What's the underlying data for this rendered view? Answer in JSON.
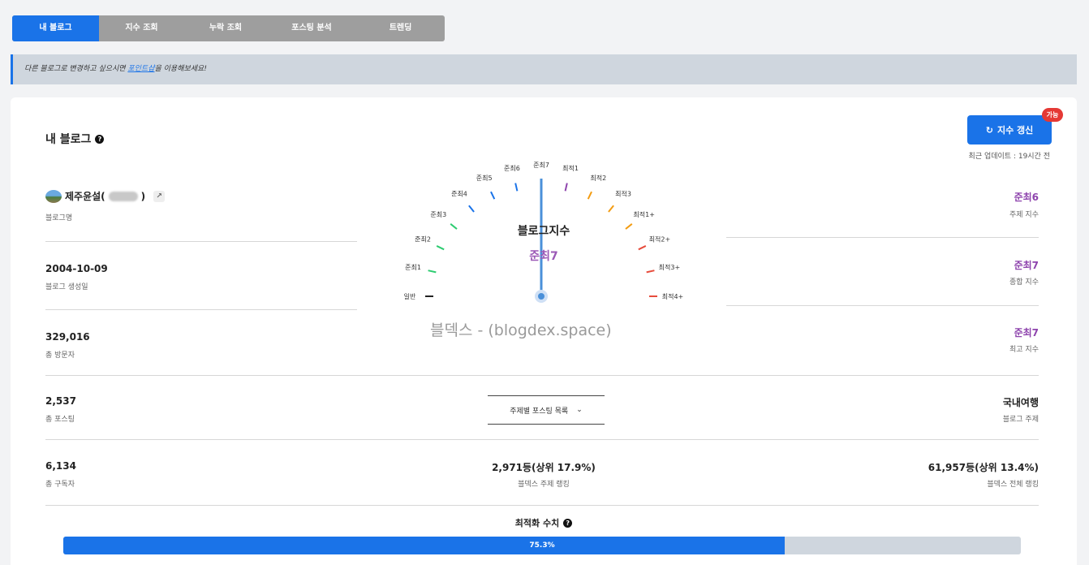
{
  "tabs": [
    {
      "label": "내 블로그",
      "active": true
    },
    {
      "label": "지수 조회"
    },
    {
      "label": "누락 조회"
    },
    {
      "label": "포스팅 분석"
    },
    {
      "label": "트렌딩"
    }
  ],
  "notice": {
    "before": "다른 블로그로 변경하고 싶으시면 ",
    "link": "포인트샵",
    "after": "을 이용해보세요!"
  },
  "card": {
    "title": "내 블로그",
    "refresh_label": "지수 갱신",
    "badge": "가능",
    "updated": "최근 업데이트 : 19시간 전"
  },
  "left": {
    "blog_name_prefix": "제주윤설(",
    "blog_name_suffix": ")",
    "blog_name_label": "블로그명",
    "created": "2004-10-09",
    "created_label": "블로그 생성일",
    "visitors": "329,016",
    "visitors_label": "총 방문자",
    "posts": "2,537",
    "posts_label": "총 포스팅",
    "subscribers": "6,134",
    "subscribers_label": "총 구독자"
  },
  "right": {
    "topic_index": "준최6",
    "topic_index_label": "주제 지수",
    "overall_index": "준최7",
    "overall_index_label": "종합 지수",
    "best_index": "준최7",
    "best_index_label": "최고 지수",
    "topic": "국내여행",
    "topic_label": "블로그 주제",
    "total_rank": "61,957등(상위 13.4%)",
    "total_rank_label": "블덱스 전체 랭킹"
  },
  "center": {
    "gauge_title": "블로그지수",
    "gauge_value": "준최7",
    "gauge_needle_level": 7,
    "gauge_labels": [
      "일반",
      "준최1",
      "준최2",
      "준최3",
      "준최4",
      "준최5",
      "준최6",
      "준최7",
      "최적1",
      "최적2",
      "최적3",
      "최적1+",
      "최적2+",
      "최적3+",
      "최적4+"
    ],
    "gauge_tick_colors": [
      "#222222",
      "#2ecc71",
      "#2ecc71",
      "#2ecc71",
      "#1a73e8",
      "#1a73e8",
      "#1a73e8",
      "#8e44ad",
      "#8e44ad",
      "#f39c12",
      "#f39c12",
      "#f39c12",
      "#e74c3c",
      "#e74c3c",
      "#e74c3c"
    ],
    "watermark": "블덱스 - (blogdex.space)",
    "dropdown": "주제별 포스팅 목록",
    "topic_rank": "2,971등(상위 17.9%)",
    "topic_rank_label": "블덱스 주제 랭킹"
  },
  "optimization": {
    "title": "최적화 수치",
    "value": 0.753,
    "text": "75.3%"
  },
  "colors": {
    "accent": "#1a73e8",
    "purple": "#8e44ad",
    "badge": "#e53935"
  }
}
